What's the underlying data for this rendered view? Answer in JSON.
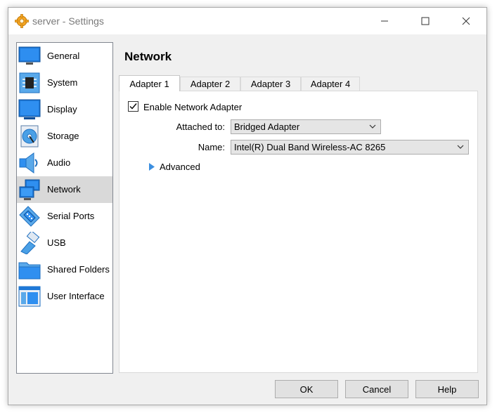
{
  "window": {
    "title": "server - Settings"
  },
  "sidebar": {
    "items": [
      {
        "label": "General"
      },
      {
        "label": "System"
      },
      {
        "label": "Display"
      },
      {
        "label": "Storage"
      },
      {
        "label": "Audio"
      },
      {
        "label": "Network",
        "selected": true
      },
      {
        "label": "Serial Ports"
      },
      {
        "label": "USB"
      },
      {
        "label": "Shared Folders"
      },
      {
        "label": "User Interface"
      }
    ]
  },
  "page": {
    "title": "Network",
    "tabs": [
      {
        "label": "Adapter 1",
        "active": true
      },
      {
        "label": "Adapter 2"
      },
      {
        "label": "Adapter 3"
      },
      {
        "label": "Adapter 4"
      }
    ],
    "enable_label": "Enable Network Adapter",
    "enable_checked": true,
    "attached_label": "Attached to:",
    "attached_value": "Bridged Adapter",
    "name_label": "Name:",
    "name_value": "Intel(R) Dual Band Wireless-AC 8265",
    "advanced_label": "Advanced"
  },
  "buttons": {
    "ok": "OK",
    "cancel": "Cancel",
    "help": "Help"
  },
  "colors": {
    "icon_blue": "#1e78d7",
    "selection": "#d9d9d9",
    "advanced_arrow": "#3c8fe0"
  }
}
